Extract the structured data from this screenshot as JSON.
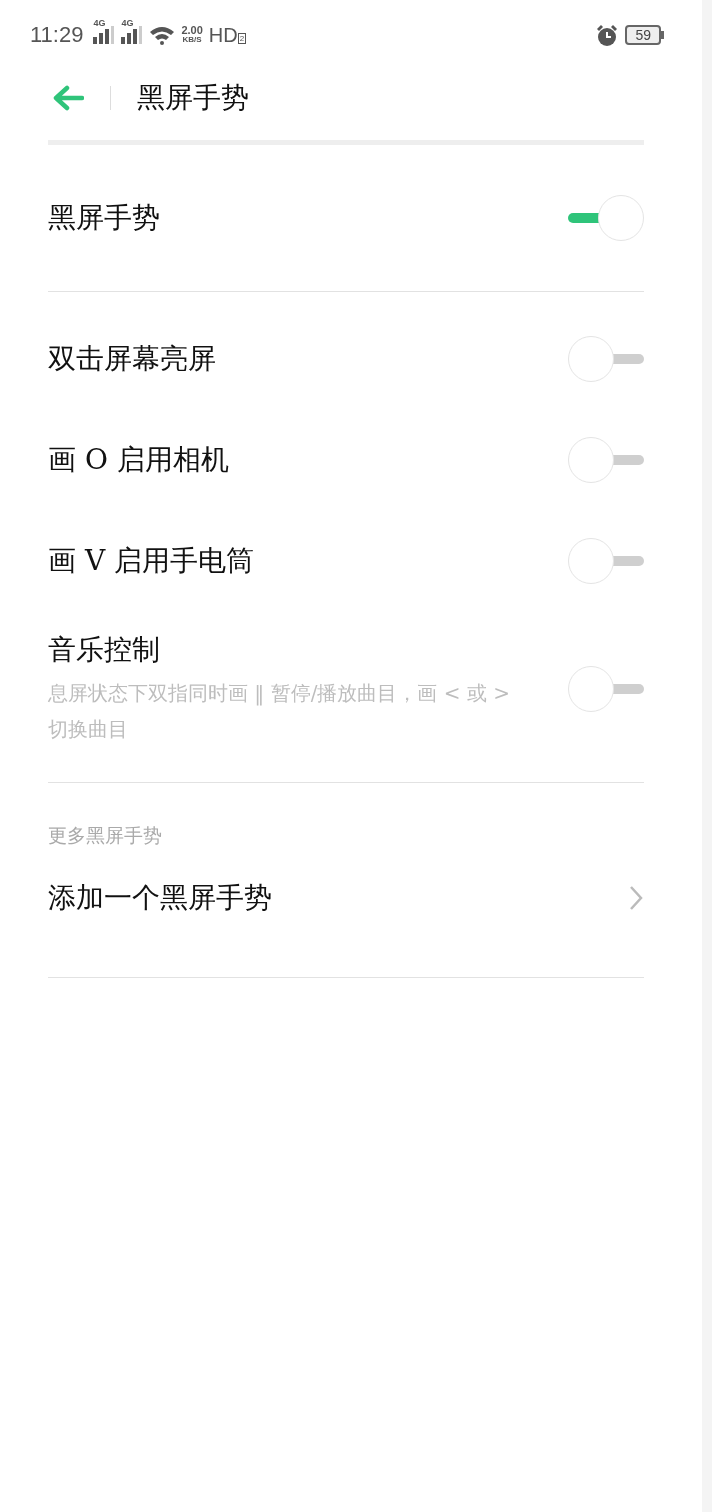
{
  "status_bar": {
    "time": "11:29",
    "signals": [
      {
        "label": "4G"
      },
      {
        "label": "4G"
      }
    ],
    "speed": {
      "value": "2.00",
      "unit": "KB/S"
    },
    "hd": "HD",
    "hd_badge": "2",
    "battery": "59"
  },
  "header": {
    "title": "黑屏手势"
  },
  "master": {
    "label": "黑屏手势",
    "on": true
  },
  "gestures": [
    {
      "label": "双击屏幕亮屏",
      "on": false
    },
    {
      "label": "画 O 启用相机",
      "on": false
    },
    {
      "label": "画 V 启用手电筒",
      "on": false
    },
    {
      "label": "音乐控制",
      "description": "息屏状态下双指同时画 ‖ 暂停/播放曲目，画 < 或 > 切换曲目",
      "on": false
    }
  ],
  "more": {
    "title": "更多黑屏手势",
    "items": [
      {
        "label": "添加一个黑屏手势"
      }
    ]
  }
}
